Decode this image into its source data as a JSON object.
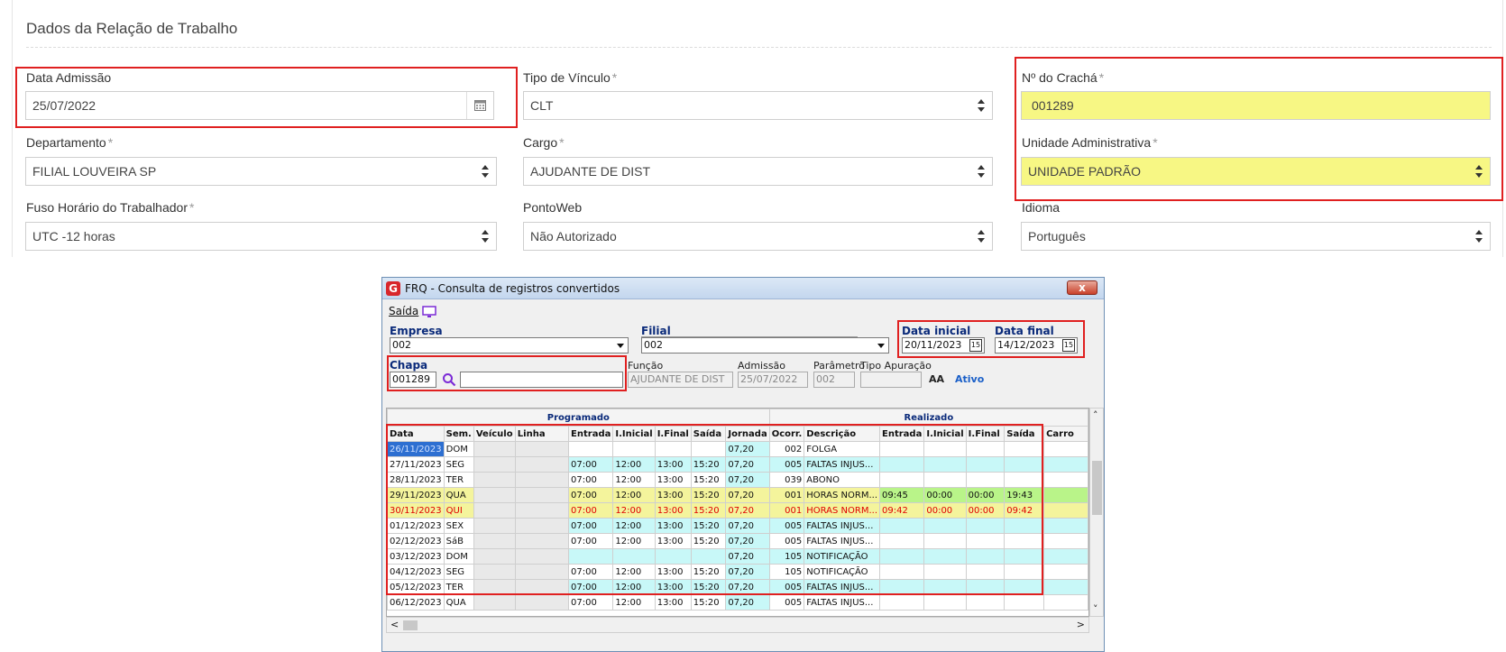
{
  "form": {
    "section_title": "Dados da Relação de Trabalho",
    "fields": {
      "data_admissao": {
        "label": "Data Admissão",
        "value": "25/07/2022"
      },
      "tipo_vinculo": {
        "label": "Tipo de Vínculo",
        "value": "CLT"
      },
      "cracha": {
        "label": "Nº do Crachá",
        "value": "001289"
      },
      "departamento": {
        "label": "Departamento",
        "value": "FILIAL LOUVEIRA SP"
      },
      "cargo": {
        "label": "Cargo",
        "value": "AJUDANTE DE DIST"
      },
      "unidade": {
        "label": "Unidade Administrativa",
        "value": "UNIDADE PADRÃO"
      },
      "fuso": {
        "label": "Fuso Horário do Trabalhador",
        "value": "UTC -12 horas"
      },
      "pontoweb": {
        "label": "PontoWeb",
        "value": "Não Autorizado"
      },
      "idioma": {
        "label": "Idioma",
        "value": "Português"
      }
    },
    "required_mark": "*",
    "colors": {
      "highlight_yellow": "#f7f784",
      "annotation_red": "#e02020"
    }
  },
  "window": {
    "title": "FRQ - Consulta de registros convertidos",
    "close_label": "x",
    "menu": {
      "saida": "Saída"
    },
    "empresa": {
      "label": "Empresa",
      "value": "002"
    },
    "filial": {
      "label": "Filial",
      "value": "002"
    },
    "data_inicial": {
      "label": "Data inicial",
      "value": "20/11/2023"
    },
    "data_final": {
      "label": "Data final",
      "value": "14/12/2023"
    },
    "chapa": {
      "label": "Chapa",
      "value": "001289"
    },
    "funcao": {
      "label": "Função",
      "value": "AJUDANTE DE DIST"
    },
    "admissao": {
      "label": "Admissão",
      "value": "25/07/2022"
    },
    "parametro": {
      "label": "Parâmetro",
      "value": "002"
    },
    "tipo_apuracao": {
      "label": "Tipo Apuração",
      "value": ""
    },
    "status": "Ativo",
    "grid": {
      "group_programado": "Programado",
      "group_realizado": "Realizado",
      "columns": [
        "Data",
        "Sem.",
        "Veículo",
        "Linha",
        "Entrada",
        "I.Inicial",
        "I.Final",
        "Saída",
        "Jornada",
        "Ocorr.",
        "Descrição",
        "Entrada",
        "I.Inicial",
        "I.Final",
        "Saída",
        "Carro"
      ],
      "rows": [
        {
          "style": "first",
          "cells": [
            "26/11/2023",
            "DOM",
            "",
            "",
            "",
            "",
            "",
            "",
            "07,20",
            "002",
            "FOLGA",
            "",
            "",
            "",
            "",
            ""
          ]
        },
        {
          "style": "cyan",
          "cells": [
            "27/11/2023",
            "SEG",
            "",
            "",
            "07:00",
            "12:00",
            "13:00",
            "15:20",
            "07,20",
            "005",
            "FALTAS INJUS...",
            "",
            "",
            "",
            "",
            ""
          ]
        },
        {
          "style": "white",
          "cells": [
            "28/11/2023",
            "TER",
            "",
            "",
            "07:00",
            "12:00",
            "13:00",
            "15:20",
            "07,20",
            "039",
            "ABONO",
            "",
            "",
            "",
            "",
            ""
          ]
        },
        {
          "style": "yellow",
          "cells": [
            "29/11/2023",
            "QUA",
            "",
            "",
            "07:00",
            "12:00",
            "13:00",
            "15:20",
            "07,20",
            "001",
            "HORAS NORM...",
            "09:45",
            "00:00",
            "00:00",
            "19:43",
            ""
          ]
        },
        {
          "style": "yellow-red",
          "cells": [
            "30/11/2023",
            "QUI",
            "",
            "",
            "07:00",
            "12:00",
            "13:00",
            "15:20",
            "07,20",
            "001",
            "HORAS NORM...",
            "09:42",
            "00:00",
            "00:00",
            "09:42",
            ""
          ]
        },
        {
          "style": "cyan",
          "cells": [
            "01/12/2023",
            "SEX",
            "",
            "",
            "07:00",
            "12:00",
            "13:00",
            "15:20",
            "07,20",
            "005",
            "FALTAS INJUS...",
            "",
            "",
            "",
            "",
            ""
          ]
        },
        {
          "style": "white",
          "cells": [
            "02/12/2023",
            "SáB",
            "",
            "",
            "07:00",
            "12:00",
            "13:00",
            "15:20",
            "07,20",
            "005",
            "FALTAS INJUS...",
            "",
            "",
            "",
            "",
            ""
          ]
        },
        {
          "style": "cyan",
          "cells": [
            "03/12/2023",
            "DOM",
            "",
            "",
            "",
            "",
            "",
            "",
            "07,20",
            "105",
            "NOTIFICAÇÃO",
            "",
            "",
            "",
            "",
            ""
          ]
        },
        {
          "style": "white",
          "cells": [
            "04/12/2023",
            "SEG",
            "",
            "",
            "07:00",
            "12:00",
            "13:00",
            "15:20",
            "07,20",
            "105",
            "NOTIFICAÇÃO",
            "",
            "",
            "",
            "",
            ""
          ]
        },
        {
          "style": "cyan",
          "cells": [
            "05/12/2023",
            "TER",
            "",
            "",
            "07:00",
            "12:00",
            "13:00",
            "15:20",
            "07,20",
            "005",
            "FALTAS INJUS...",
            "",
            "",
            "",
            "",
            ""
          ]
        },
        {
          "style": "white",
          "cells": [
            "06/12/2023",
            "QUA",
            "",
            "",
            "07:00",
            "12:00",
            "13:00",
            "15:20",
            "07,20",
            "005",
            "FALTAS INJUS...",
            "",
            "",
            "",
            "",
            ""
          ]
        }
      ]
    }
  }
}
